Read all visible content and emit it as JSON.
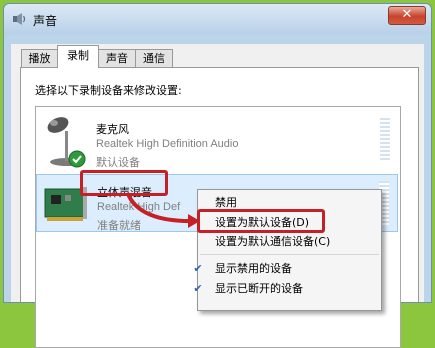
{
  "window": {
    "title": "声音",
    "close_label": "✕",
    "icon": "speaker-icon"
  },
  "tabs": [
    {
      "label": "播放",
      "active": false
    },
    {
      "label": "录制",
      "active": true
    },
    {
      "label": "声音",
      "active": false
    },
    {
      "label": "通信",
      "active": false
    }
  ],
  "instructions": "选择以下录制设备来修改设置:",
  "devices": [
    {
      "name": "麦克风",
      "description": "Realtek High Definition Audio",
      "status": "默认设备",
      "icon": "microphone-icon",
      "badge": "green-check-icon"
    },
    {
      "name": "立体声混音",
      "description": "Realtek High Def",
      "status": "准备就绪",
      "icon": "sound-card-icon"
    }
  ],
  "context_menu": {
    "items": [
      {
        "label": "禁用",
        "checked": false
      },
      {
        "label": "设置为默认设备(D)",
        "checked": false
      },
      {
        "label": "设置为默认通信设备(C)",
        "checked": false
      },
      {
        "label": "显示禁用的设备",
        "checked": true
      },
      {
        "label": "显示已断开的设备",
        "checked": true
      }
    ]
  },
  "colors": {
    "annotation_red": "#c62026",
    "background_green": "#8cc63f",
    "selection_blue": "#dceefe"
  }
}
